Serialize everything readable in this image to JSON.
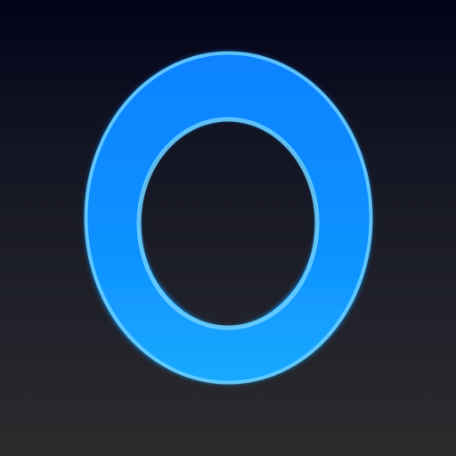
{
  "icon": {
    "name": "o-letter-icon",
    "colors": {
      "background_top": "#02021a",
      "background_bottom": "#2b2b2d",
      "ring_top": "#0a82ff",
      "ring_bottom": "#1aaaff",
      "ring_outline": "#6fd0ff"
    }
  }
}
